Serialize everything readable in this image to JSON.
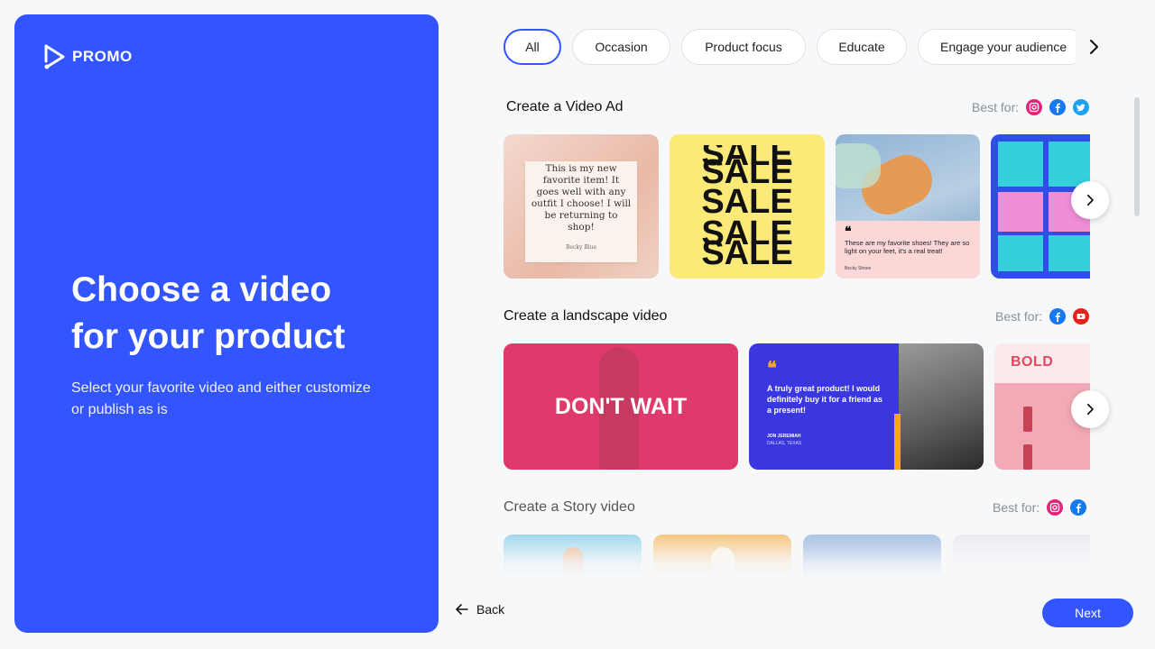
{
  "brand": {
    "name": "PROMO"
  },
  "hero": {
    "title_line1": "Choose a video",
    "title_line2": "for your product",
    "subtitle": "Select your favorite video and either customize or publish as is"
  },
  "filters": {
    "chips": [
      "All",
      "Occasion",
      "Product focus",
      "Educate",
      "Engage your audience"
    ],
    "selected": "All",
    "next_icon": "chevron-right-icon"
  },
  "sections": [
    {
      "title": "Create a Video Ad",
      "best_for_label": "Best for:",
      "platforms": [
        "instagram-icon",
        "facebook-icon",
        "twitter-icon"
      ],
      "thumbnails": [
        {
          "quote": "This is my new favorite item! It goes well with any outfit I choose! I will be returning to shop!",
          "author": "Becky Blue"
        },
        {
          "word": "SALE"
        },
        {
          "quote": "These are my favorite shoes! They are so light on your feet, it's a real treat!",
          "author": "Becky Shoes"
        },
        {}
      ]
    },
    {
      "title": "Create a landscape video",
      "best_for_label": "Best for:",
      "platforms": [
        "facebook-icon",
        "youtube-icon"
      ],
      "thumbnails": [
        {
          "headline": "DON'T WAIT"
        },
        {
          "quote": "A truly great product! I would definitely buy it for a friend as a present!",
          "name": "JON JEREMIAH",
          "location": "DALLAS, TEXAS"
        },
        {
          "headline": "BOLD"
        }
      ]
    },
    {
      "title": "Create a Story video",
      "best_for_label": "Best for:",
      "platforms": [
        "instagram-icon",
        "facebook-icon"
      ]
    }
  ],
  "footer": {
    "back_label": "Back",
    "next_label": "Next"
  },
  "colors": {
    "accent": "#3355ff",
    "instagram": "#e4237a",
    "facebook": "#1877f2",
    "twitter": "#1da1f2",
    "youtube": "#e62117"
  }
}
